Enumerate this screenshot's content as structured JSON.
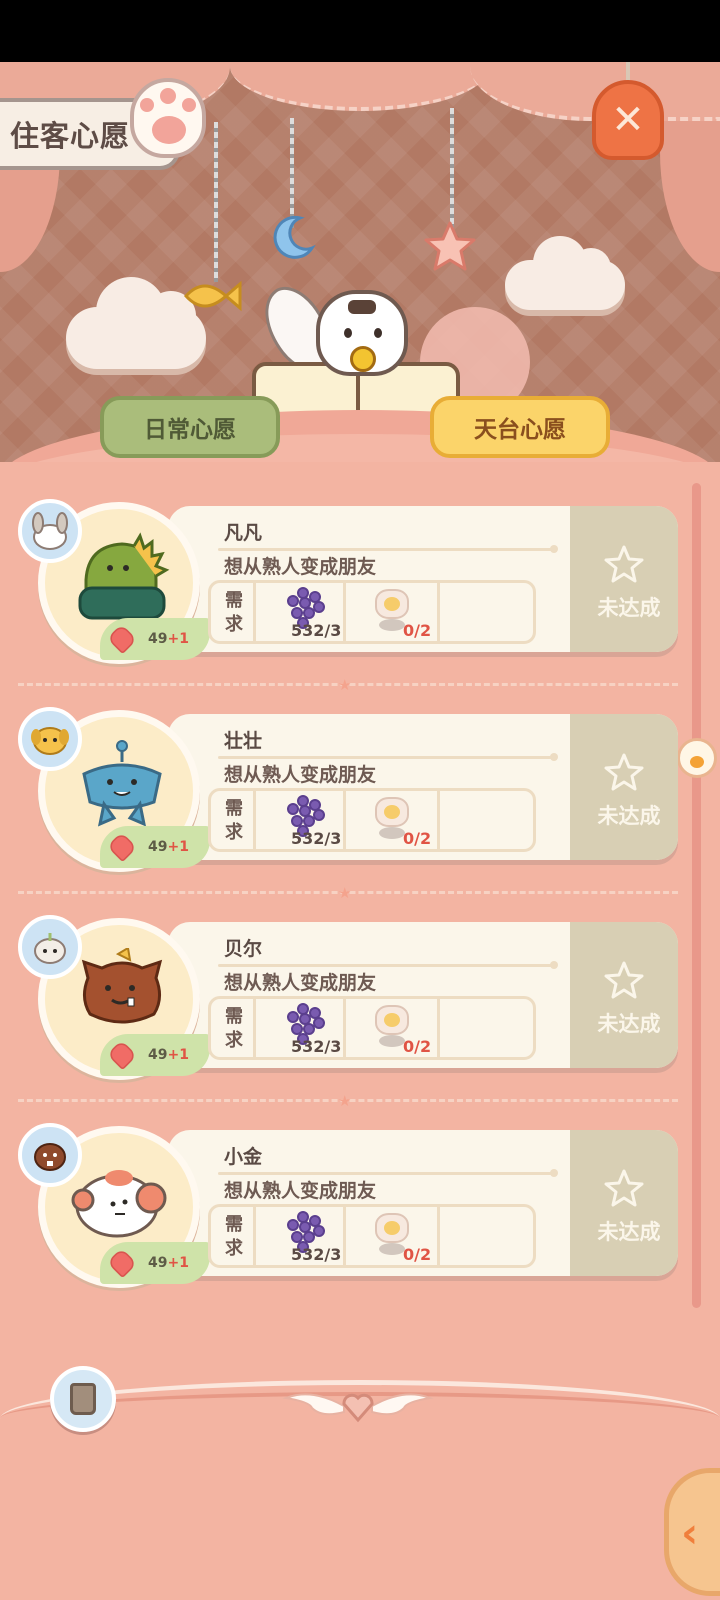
{
  "header": {
    "title": "住客心愿",
    "close_icon": "x-icon"
  },
  "tabs": [
    {
      "label": "日常心愿",
      "active": false
    },
    {
      "label": "天台心愿",
      "active": true
    }
  ],
  "wishes": [
    {
      "name": "凡凡",
      "desc": "想从熟人变成朋友",
      "req_label": "需求",
      "heart_value": "49",
      "heart_bonus": "+1",
      "item1_count": "532/3",
      "item2_count": "0/2",
      "status": "未达成",
      "char_color": "#6f8f3a",
      "avatar_color": "#d3c9bf"
    },
    {
      "name": "壮壮",
      "desc": "想从熟人变成朋友",
      "req_label": "需求",
      "heart_value": "49",
      "heart_bonus": "+1",
      "item1_count": "532/3",
      "item2_count": "0/2",
      "status": "未达成",
      "char_color": "#5aa6c9",
      "avatar_color": "#f5c24b"
    },
    {
      "name": "贝尔",
      "desc": "想从熟人变成朋友",
      "req_label": "需求",
      "heart_value": "49",
      "heart_bonus": "+1",
      "item1_count": "532/3",
      "item2_count": "0/2",
      "status": "未达成",
      "char_color": "#a4512f",
      "avatar_color": "#f3eee7"
    },
    {
      "name": "小金",
      "desc": "想从熟人变成朋友",
      "req_label": "需求",
      "heart_value": "49",
      "heart_bonus": "+1",
      "item1_count": "532/3",
      "item2_count": "0/2",
      "status": "未达成",
      "char_color": "#ef8a6e",
      "avatar_color": "#8f4a2c"
    }
  ],
  "colors": {
    "background": "#f3b4a2",
    "tab_active": "#fbd46a",
    "tab_inactive": "#aabd7b",
    "bonus_red": "#e05445"
  }
}
